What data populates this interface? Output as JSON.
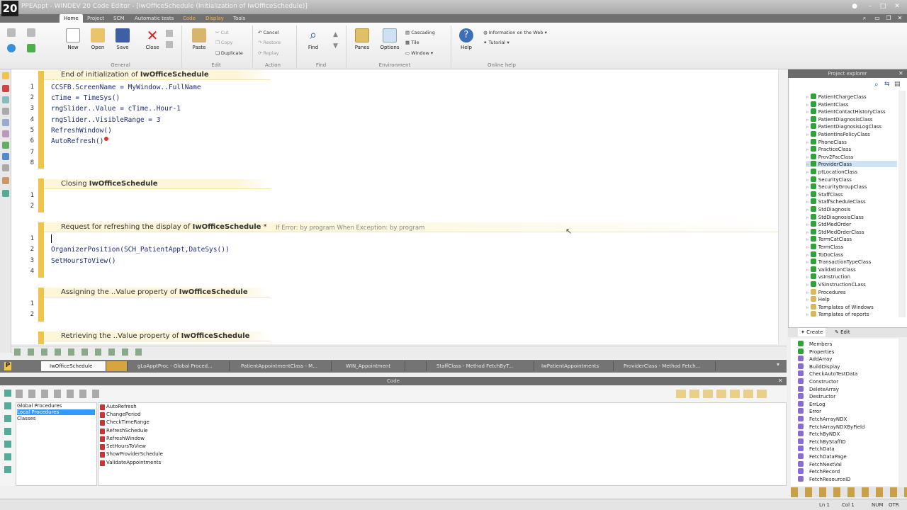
{
  "window": {
    "title": "PPEAppt - WINDEV 20  Code Editor - [IwOfficeSchedule (Initialization of IwOfficeSchedule)]",
    "logo": "20"
  },
  "menu": [
    "Home",
    "Project",
    "SCM",
    "Automatic tests",
    "Code",
    "Display",
    "Tools"
  ],
  "ribbon": {
    "new": "New",
    "open": "Open",
    "save": "Save",
    "close": "Close",
    "paste": "Paste",
    "cut": "Cut",
    "copy": "Copy",
    "duplicate": "Duplicate",
    "cancel": "Cancel",
    "restore": "Restore",
    "replay": "Replay",
    "find": "Find",
    "panes": "Panes",
    "options": "Options",
    "help": "Help",
    "cascading": "Cascading",
    "tile": "Tile",
    "window": "Window",
    "info_web": "Information on the Web",
    "tutorial": "Tutorial",
    "groups": [
      "General",
      "Edit",
      "Action",
      "Find",
      "Environment",
      "Online help"
    ]
  },
  "editor": {
    "sections": [
      {
        "prefix": "End of initialization of ",
        "name": "IwOfficeSchedule",
        "suffix": ""
      },
      {
        "prefix": "Closing ",
        "name": "IwOfficeSchedule",
        "suffix": ""
      },
      {
        "prefix": "Request for refreshing the display of ",
        "name": "IwOfficeSchedule",
        "suffix": " *",
        "note": "If Error: by program   When Exception: by program"
      },
      {
        "prefix": "Assigning the ..Value property of ",
        "name": "IwOfficeSchedule",
        "suffix": ""
      },
      {
        "prefix": "Retrieving the ..Value property of ",
        "name": "IwOfficeSchedule",
        "suffix": ""
      }
    ],
    "lines1": [
      "CCSFB.ScreenName = MyWindow..FullName",
      "cTime = TimeSys()",
      "rngSlider..Value = cTime..Hour-1",
      "rngSlider..VisibleRange = 3",
      "RefreshWindow()",
      "AutoRefresh()",
      "",
      ""
    ],
    "lines3": [
      "",
      "OrganizerPosition(SCH_PatientAppt,DateSys())",
      "SetHoursToView()",
      ""
    ]
  },
  "project_explorer": {
    "title": "Project explorer",
    "items": [
      "PatientChargeClass",
      "PatientClass",
      "PatientContactHistoryClass",
      "PatientDiagnosisClass",
      "PatientDiagnosisLogClass",
      "PatientInsPolicyClass",
      "PhoneClass",
      "PracticeClass",
      "Prov2FacClass",
      "ProviderClass",
      "ptLocationClass",
      "SecurityClass",
      "SecurityGroupClass",
      "StaffClass",
      "StaffScheduleClass",
      "StdDiagnosis",
      "StdDiagnosisClass",
      "StdMedOrder",
      "StdMedOrderClass",
      "TermCatClass",
      "TermClass",
      "ToDoClass",
      "TransactionTypeClass",
      "ValidationClass",
      "vsInstruction",
      "VSInstructionCLass",
      "Procedures",
      "Help",
      "Templates of Windows",
      "Templates of reports"
    ],
    "selected": "ProviderClass",
    "tabs": [
      "Create",
      "Edit"
    ]
  },
  "members": [
    "Members",
    "Properties",
    "AddArray",
    "BuildDisplay",
    "CheckAutoTestData",
    "Constructor",
    "DeleteArray",
    "Destructor",
    "ErrLog",
    "Error",
    "FetchArrayNDX",
    "FetchArrayNDXByField",
    "FetchByNDX",
    "FetchByStaffID",
    "FetchData",
    "FetchDataPage",
    "FetchNextVal",
    "FetchRecord",
    "FetchResourceID"
  ],
  "doc_tabs": [
    "IwOfficeSchedule",
    "",
    "gLoApptProc - Global Proced...",
    "PatientAppointmentClass - M...",
    "WIN_Appointment",
    "",
    "StaffClass - Method FetchByT...",
    "IwPatientAppointments",
    "ProviderClass - Method Fetch..."
  ],
  "code_pane": {
    "title": "Code",
    "categories": [
      "Global Procedures",
      "Local Procedures",
      "Classes"
    ],
    "selected_category": "Local Procedures",
    "procedures": [
      "AutoRefresh",
      "ChangePeriod",
      "CheckTimeRange",
      "RefreshSchedule",
      "RefreshWindow",
      "SetHoursToView",
      "ShowProviderSchedule",
      "ValidateAppointments"
    ]
  },
  "status": {
    "line": "Ln 1",
    "col": "Col 1",
    "caps": "NUM",
    "ovr": "OTR"
  }
}
